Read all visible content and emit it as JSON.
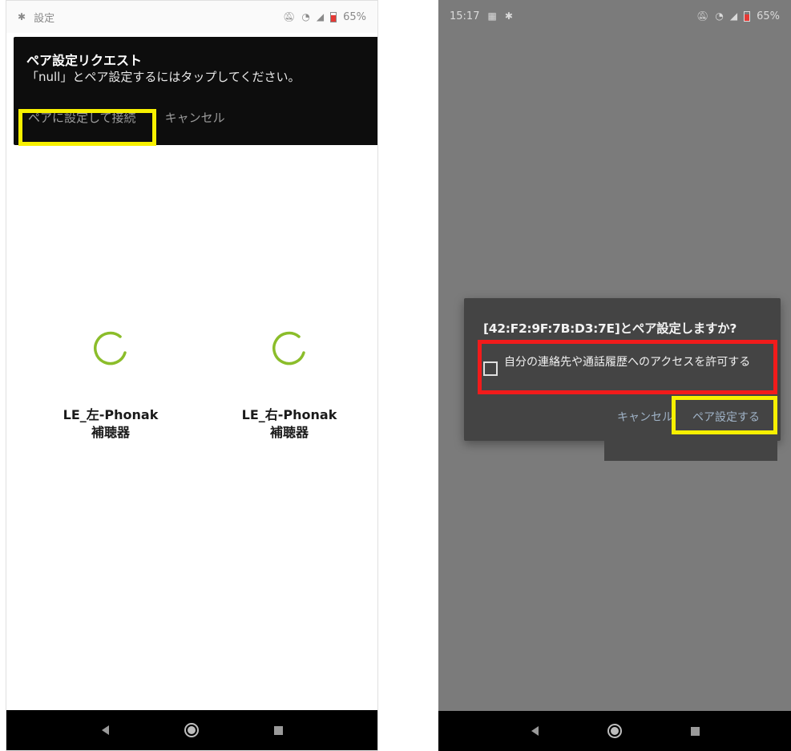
{
  "left_screen": {
    "status_bar": {
      "app_label": "設定",
      "battery": "65%"
    },
    "notification": {
      "title": "ペア設定リクエスト",
      "body": "「null」とペア設定するにはタップしてください。",
      "pair_action": "ペアに設定して接続",
      "cancel_action": "キャンセル"
    },
    "devices": [
      {
        "name": "LE_左-Phonak",
        "type": "補聴器"
      },
      {
        "name": "LE_右-Phonak",
        "type": "補聴器"
      }
    ]
  },
  "right_screen": {
    "status_bar": {
      "time": "15:17",
      "battery": "65%"
    },
    "dialog": {
      "title": "[42:F2:9F:7B:D3:7E]とペア設定しますか?",
      "checkbox_label": "自分の連絡先や通話履歴へのアクセスを許可する",
      "checkbox_checked": false,
      "cancel_label": "キャンセル",
      "pair_label": "ペア設定する"
    }
  },
  "colors": {
    "highlight_yellow": "#f7f000",
    "highlight_red": "#f21b1b",
    "spinner_green": "#8bbd2a",
    "dialog_bg": "#444444",
    "screen_dim": "#7b7b7b"
  },
  "icons": [
    "bluetooth-icon",
    "mute-icon",
    "wifi-icon",
    "signal-icon",
    "battery-icon",
    "calendar-icon",
    "back-icon",
    "home-icon",
    "recents-icon"
  ]
}
